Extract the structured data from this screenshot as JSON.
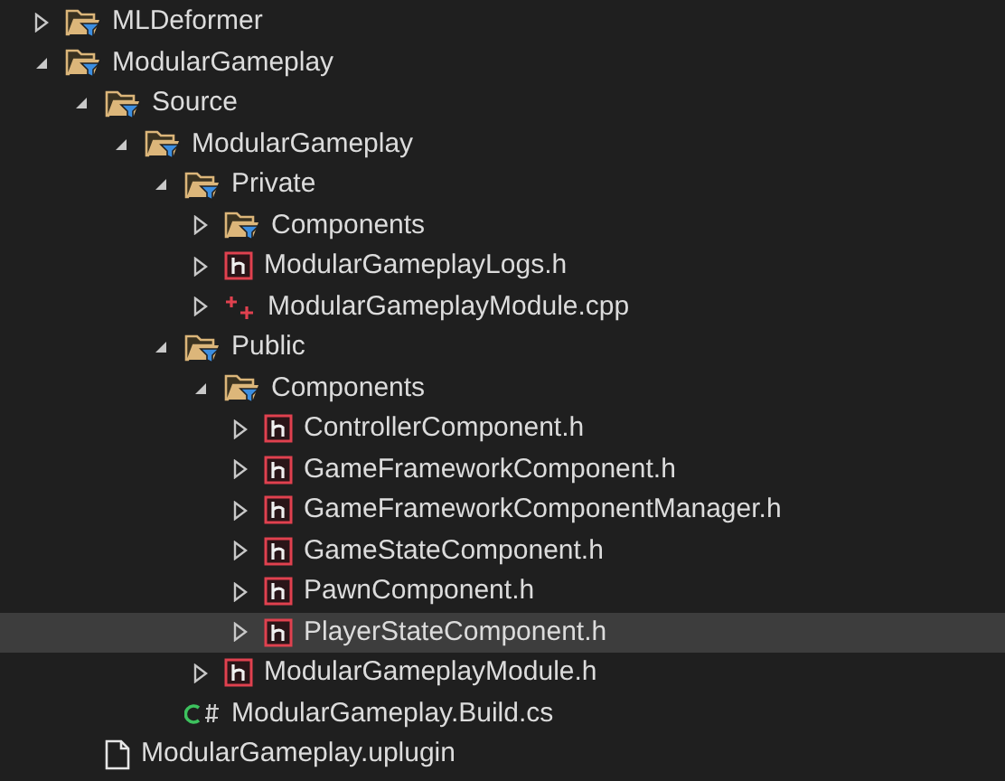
{
  "tree": [
    {
      "label": "MLDeformer",
      "kind": "folder",
      "expanded": false,
      "selected": false
    },
    {
      "label": "ModularGameplay",
      "kind": "folder",
      "expanded": true,
      "selected": false,
      "children": [
        {
          "label": "Source",
          "kind": "folder",
          "expanded": true,
          "selected": false,
          "children": [
            {
              "label": "ModularGameplay",
              "kind": "folder",
              "expanded": true,
              "selected": false,
              "children": [
                {
                  "label": "Private",
                  "kind": "folder",
                  "expanded": true,
                  "selected": false,
                  "children": [
                    {
                      "label": "Components",
                      "kind": "folder",
                      "expanded": false,
                      "selected": false
                    },
                    {
                      "label": "ModularGameplayLogs.h",
                      "kind": "header",
                      "expanded": false,
                      "selected": false
                    },
                    {
                      "label": "ModularGameplayModule.cpp",
                      "kind": "cpp",
                      "expanded": false,
                      "selected": false
                    }
                  ]
                },
                {
                  "label": "Public",
                  "kind": "folder",
                  "expanded": true,
                  "selected": false,
                  "children": [
                    {
                      "label": "Components",
                      "kind": "folder",
                      "expanded": true,
                      "selected": false,
                      "children": [
                        {
                          "label": "ControllerComponent.h",
                          "kind": "header",
                          "expanded": false,
                          "selected": false
                        },
                        {
                          "label": "GameFrameworkComponent.h",
                          "kind": "header",
                          "expanded": false,
                          "selected": false
                        },
                        {
                          "label": "GameFrameworkComponentManager.h",
                          "kind": "header",
                          "expanded": false,
                          "selected": false
                        },
                        {
                          "label": "GameStateComponent.h",
                          "kind": "header",
                          "expanded": false,
                          "selected": false
                        },
                        {
                          "label": "PawnComponent.h",
                          "kind": "header",
                          "expanded": false,
                          "selected": false
                        },
                        {
                          "label": "PlayerStateComponent.h",
                          "kind": "header",
                          "expanded": false,
                          "selected": true
                        }
                      ]
                    },
                    {
                      "label": "ModularGameplayModule.h",
                      "kind": "header",
                      "expanded": false,
                      "selected": false
                    }
                  ]
                },
                {
                  "label": "ModularGameplay.Build.cs",
                  "kind": "csharp",
                  "selected": false
                }
              ]
            }
          ]
        },
        {
          "label": "ModularGameplay.uplugin",
          "kind": "plugin",
          "selected": false
        }
      ]
    }
  ]
}
